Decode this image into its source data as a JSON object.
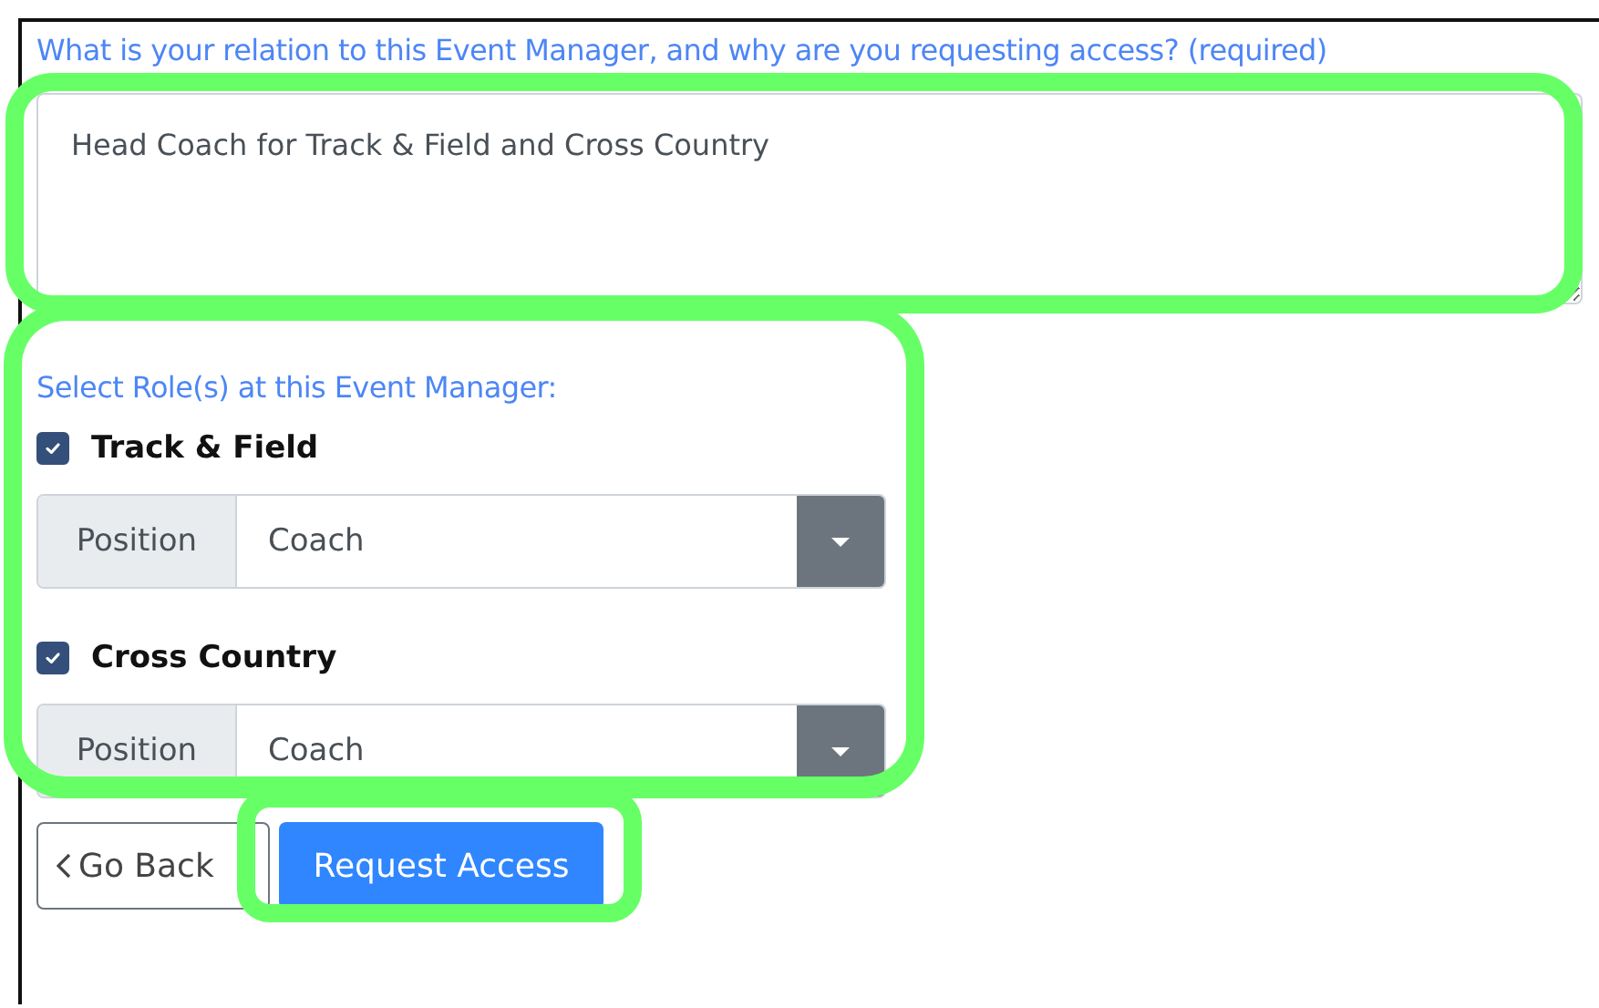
{
  "question": {
    "label": "What is your relation to this Event Manager, and why are you requesting access? (required)",
    "value": "Head Coach for Track & Field and Cross Country",
    "highlighted": true
  },
  "roles": {
    "label": "Select Role(s) at this Event Manager:",
    "highlighted": true,
    "items": [
      {
        "name": "Track & Field",
        "checked": true,
        "addon": "Position",
        "value": "Coach"
      },
      {
        "name": "Cross Country",
        "checked": true,
        "addon": "Position",
        "value": "Coach"
      }
    ]
  },
  "buttons": [
    {
      "kind": "back",
      "label": "Go Back",
      "highlighted": false
    },
    {
      "kind": "primary",
      "label": "Request Access",
      "highlighted": true
    }
  ]
}
